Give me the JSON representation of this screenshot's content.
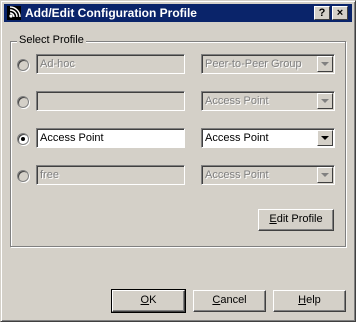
{
  "window": {
    "title": "Add/Edit Configuration Profile",
    "help_button": "?",
    "close_button": "×"
  },
  "group": {
    "label": "Select Profile"
  },
  "profiles": [
    {
      "name": "Ad-hoc",
      "mode": "Peer-to-Peer Group",
      "selected": false,
      "enabled": false
    },
    {
      "name": "",
      "mode": "Access Point",
      "selected": false,
      "enabled": false
    },
    {
      "name": "Access Point",
      "mode": "Access Point",
      "selected": true,
      "enabled": true
    },
    {
      "name": "free",
      "mode": "Access Point",
      "selected": false,
      "enabled": false
    }
  ],
  "buttons": {
    "edit_profile": {
      "accel": "E",
      "rest": "dit Profile"
    },
    "ok": {
      "accel": "O",
      "rest": "K"
    },
    "cancel": {
      "accel": "C",
      "rest": "ancel"
    },
    "help": {
      "accel": "H",
      "rest": "elp"
    }
  },
  "colors": {
    "titlebar": "#0a246a",
    "face": "#d4d0c8"
  }
}
